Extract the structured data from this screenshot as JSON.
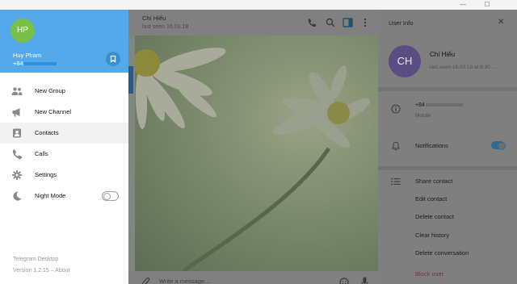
{
  "window": {
    "minimize_glyph": "—",
    "maximize_glyph": "☐"
  },
  "user": {
    "initials": "HP",
    "name": "Huy Pham",
    "phone_prefix": "+84"
  },
  "menu": [
    {
      "label": "New Group",
      "icon": "group-icon"
    },
    {
      "label": "New Channel",
      "icon": "megaphone-icon"
    },
    {
      "label": "Contacts",
      "icon": "contact-card-icon",
      "active": true
    },
    {
      "label": "Calls",
      "icon": "phone-icon"
    },
    {
      "label": "Settings",
      "icon": "gear-icon"
    },
    {
      "label": "Night Mode",
      "icon": "moon-icon",
      "toggle": false
    }
  ],
  "app": {
    "name": "Telegram Desktop",
    "version": "Version 1.2.15 – About"
  },
  "chat": {
    "title": "Chí Hiếu",
    "status": "last seen 16.03.18",
    "compose_placeholder": "Write a message..."
  },
  "info": {
    "title": "User Info",
    "close_glyph": "✕",
    "initials": "CH",
    "name": "Chí Hiếu",
    "last_seen": "last seen 16.03.18 at 8:30 ...",
    "phone_prefix": "+84",
    "phone_type": "Mobile",
    "notifications_label": "Notifications",
    "notifications_on": true,
    "actions": {
      "share": "Share contact",
      "edit": "Edit contact",
      "delete": "Delete contact",
      "clear": "Clear history",
      "delete_conv": "Delete conversation",
      "block": "Block user"
    }
  },
  "colors": {
    "drawer_header": "#54a9eb",
    "avatar_hp": "#77c14b",
    "avatar_ch": "#5a4d82",
    "dim_overlay": "#7f7f7f",
    "block_user": "#9b1f1f"
  }
}
